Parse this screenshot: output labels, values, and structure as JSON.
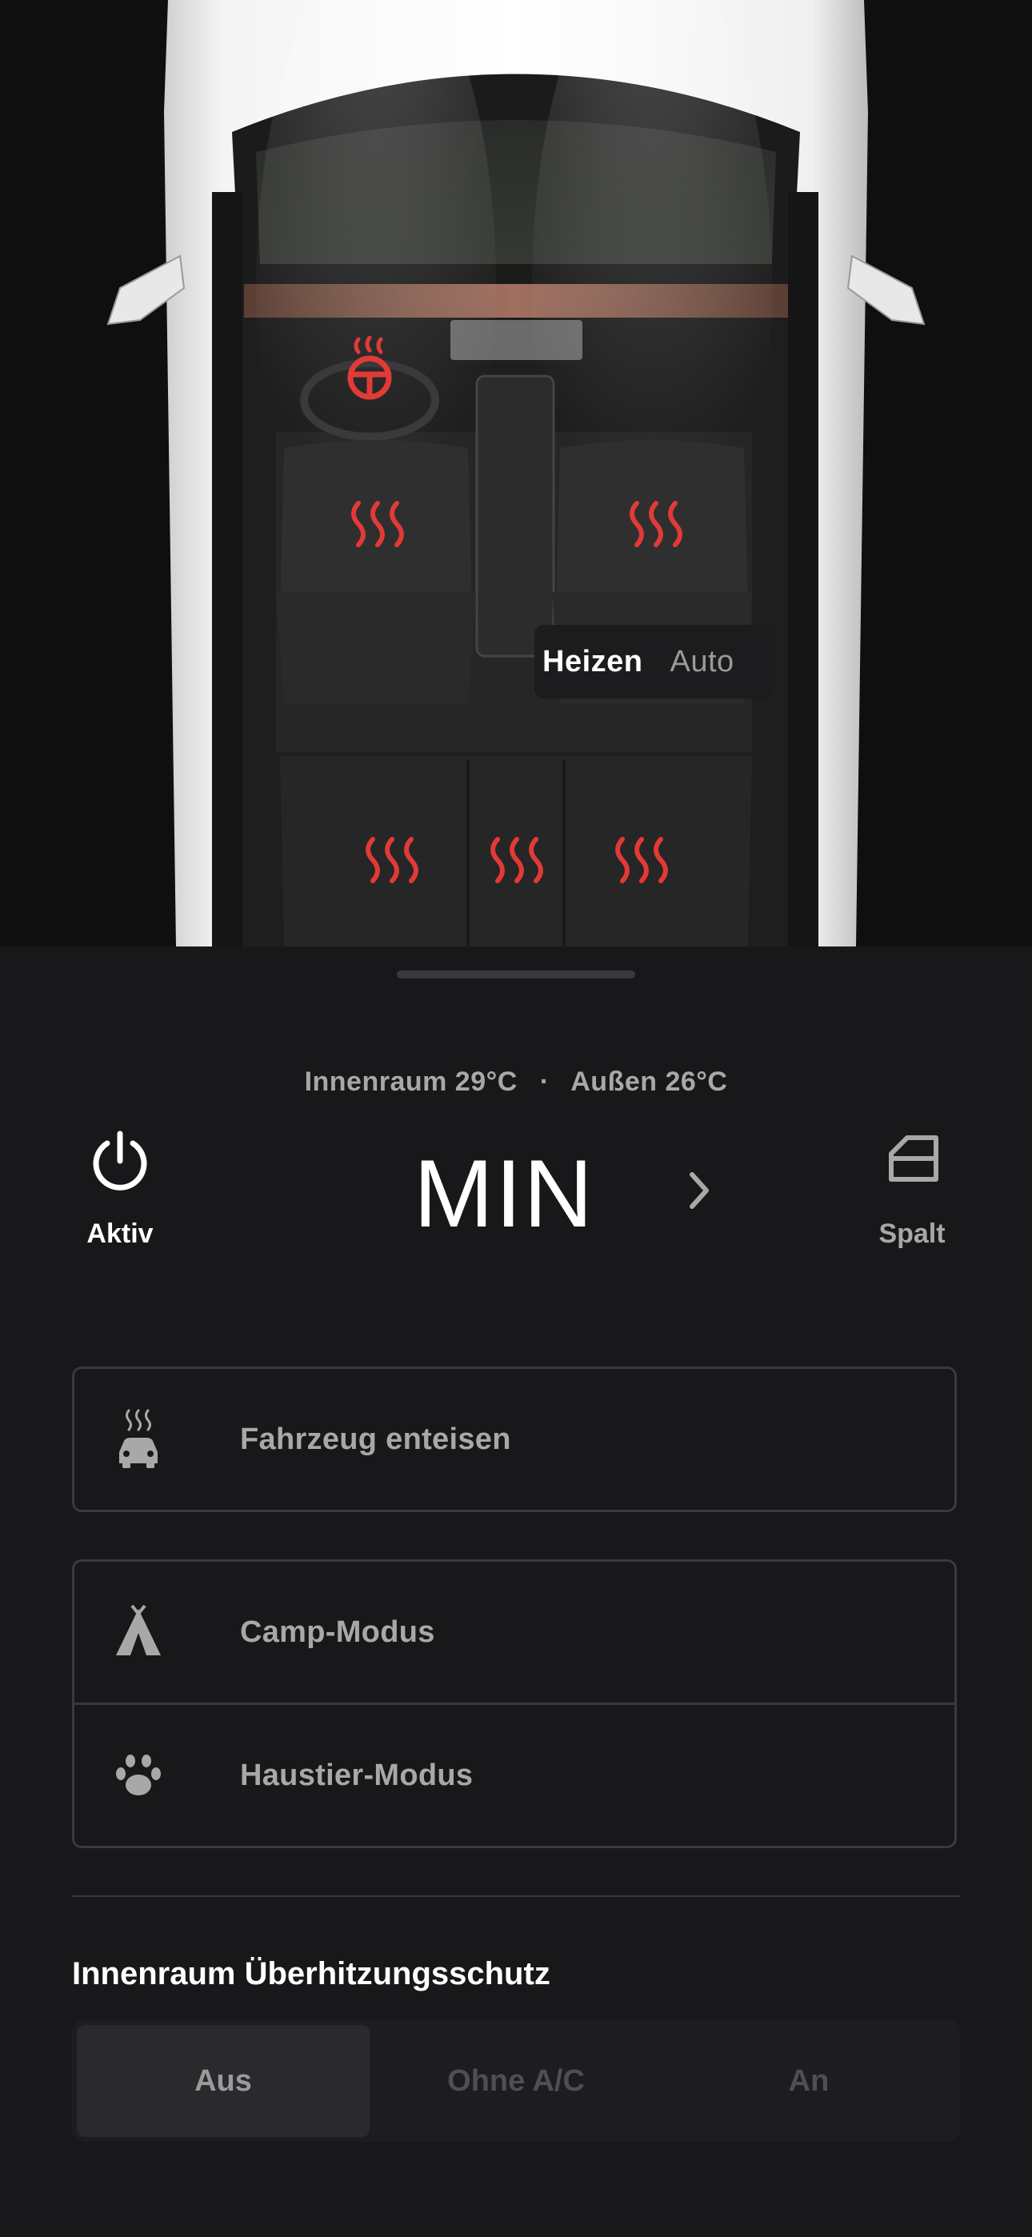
{
  "car_view": {
    "climate_mode": {
      "heat_label": "Heizen",
      "auto_label": "Auto",
      "selected": "Heizen"
    },
    "heat_color": "#e23a36"
  },
  "status": {
    "interior_label": "Innenraum 29°C",
    "separator": "·",
    "exterior_label": "Außen 26°C"
  },
  "controls": {
    "power_label": "Aktiv",
    "setpoint": "MIN",
    "vent_label": "Spalt"
  },
  "actions": {
    "defrost_label": "Fahrzeug enteisen",
    "camp_label": "Camp-Modus",
    "pet_label": "Haustier-Modus"
  },
  "overheat": {
    "title": "Innenraum Überhitzungsschutz",
    "options": [
      "Aus",
      "Ohne A/C",
      "An"
    ],
    "selected": "Aus"
  }
}
